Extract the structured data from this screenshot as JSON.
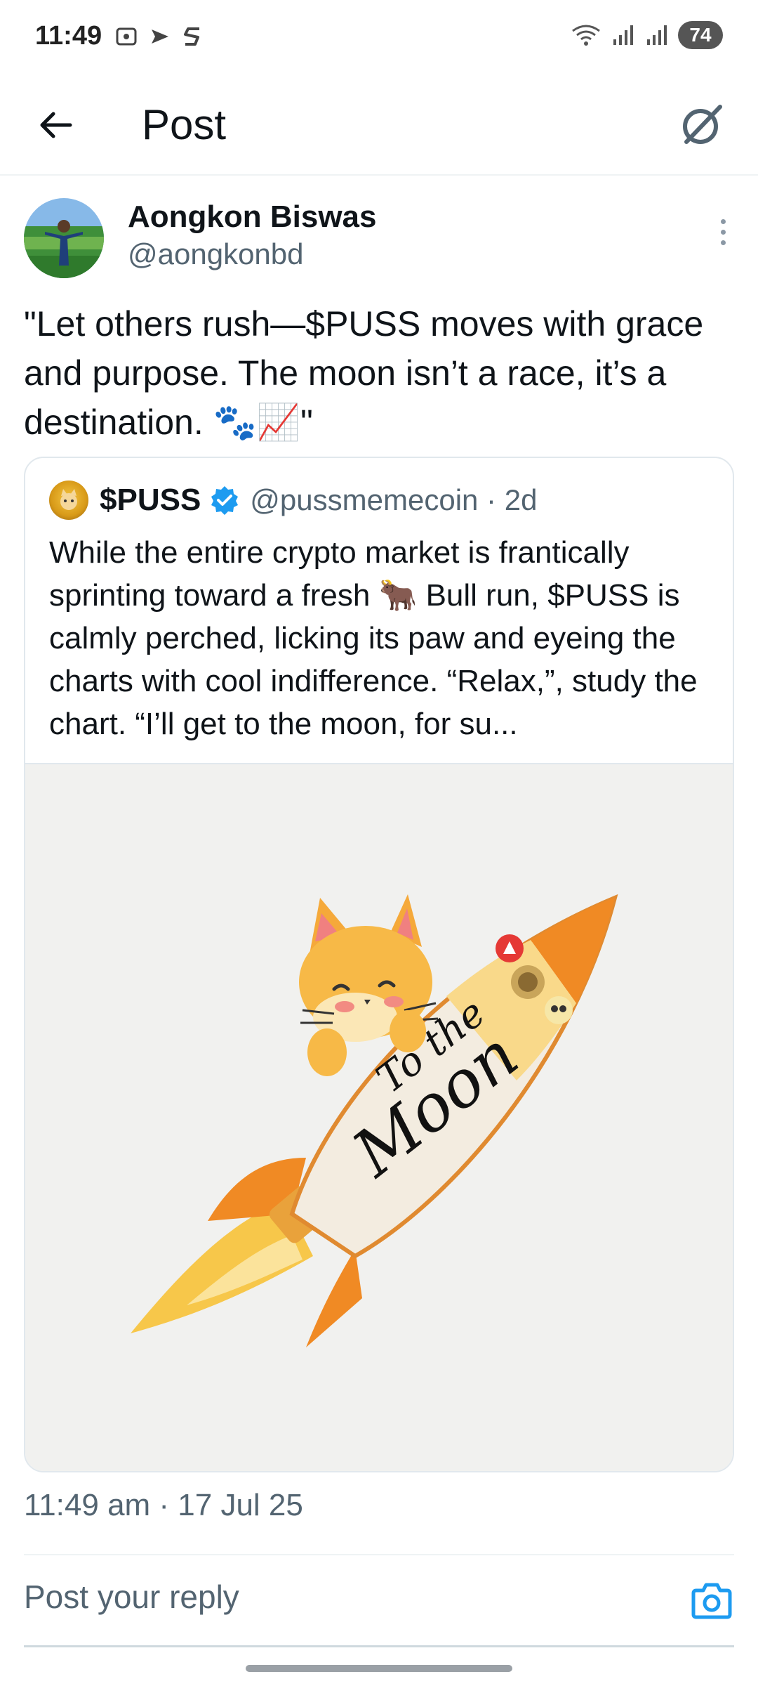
{
  "status_bar": {
    "time": "11:49",
    "battery": "74"
  },
  "header": {
    "title": "Post"
  },
  "post": {
    "author_name": "Aongkon Biswas",
    "author_handle": "@aongkonbd",
    "text": "\"Let others rush—$PUSS moves with grace and purpose. The moon isn’t a race, it’s a destination. 🐾📈\"",
    "timestamp": "11:49 am · 17 Jul 25"
  },
  "quote": {
    "name": "$PUSS",
    "handle": "@pussmemecoin · 2d",
    "text": "While the entire crypto market is frantically sprinting toward a fresh 🐂 Bull run, $PUSS is calmly perched, licking its paw and eyeing the charts with cool indifference. “Relax,”, study the chart. “I’ll get to the moon, for su...",
    "image": {
      "rocket_text_line1": "To the",
      "rocket_text_line2": "Moon"
    }
  },
  "reply": {
    "placeholder": "Post your reply"
  },
  "colors": {
    "accent": "#1d9bf0",
    "text_primary": "#0f1419",
    "text_secondary": "#536471"
  }
}
